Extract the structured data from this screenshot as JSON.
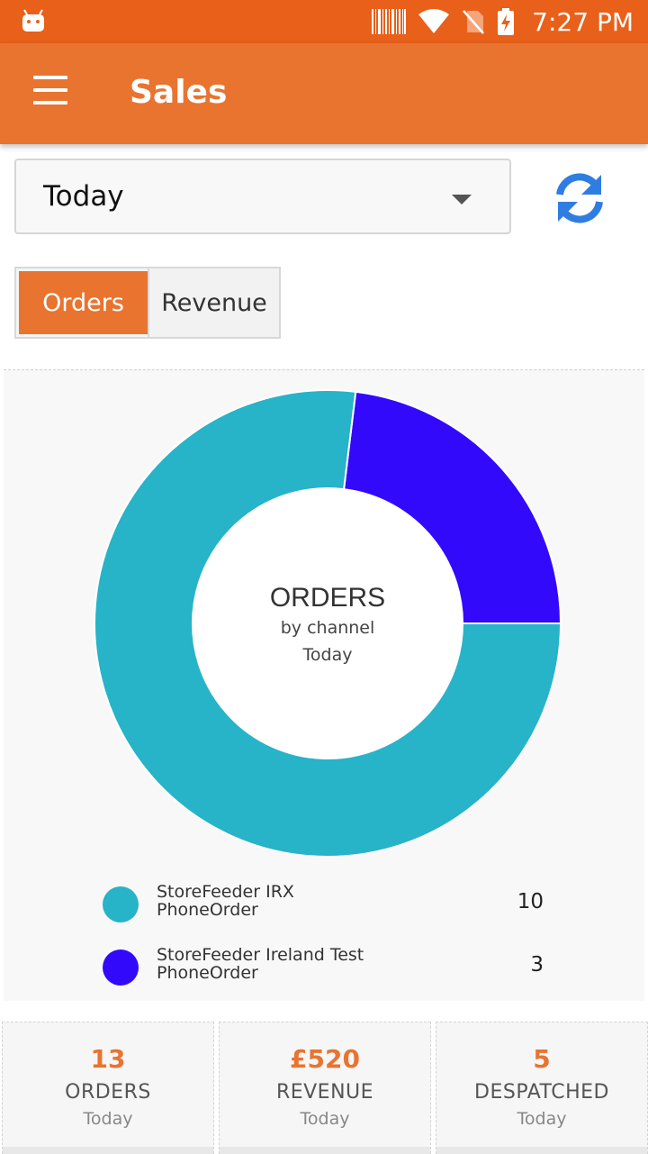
{
  "status_bar": {
    "time": "7:27 PM"
  },
  "app_bar": {
    "title": "Sales",
    "menu_icon": "hamburger-menu-icon"
  },
  "filter": {
    "period": "Today",
    "refresh_icon": "refresh-icon"
  },
  "tabs": [
    {
      "label": "Orders",
      "active": true
    },
    {
      "label": "Revenue",
      "active": false
    }
  ],
  "chart_data": {
    "type": "pie",
    "title": "ORDERS",
    "subtitle": "by channel",
    "period": "Today",
    "series": [
      {
        "name_line1": "StoreFeeder IRX",
        "name_line2": "PhoneOrder",
        "value": 10,
        "color": "#27b3c8"
      },
      {
        "name_line1": "StoreFeeder Ireland Test",
        "name_line2": "PhoneOrder",
        "value": 3,
        "color": "#3309fb"
      }
    ]
  },
  "summary": [
    {
      "value": "13",
      "label": "ORDERS",
      "period": "Today"
    },
    {
      "value": "£520",
      "label": "REVENUE",
      "period": "Today"
    },
    {
      "value": "5",
      "label": "DESPATCHED",
      "period": "Today"
    }
  ],
  "colors": {
    "accent": "#e87430",
    "status_bar": "#e8601a",
    "refresh": "#2f7de1"
  }
}
